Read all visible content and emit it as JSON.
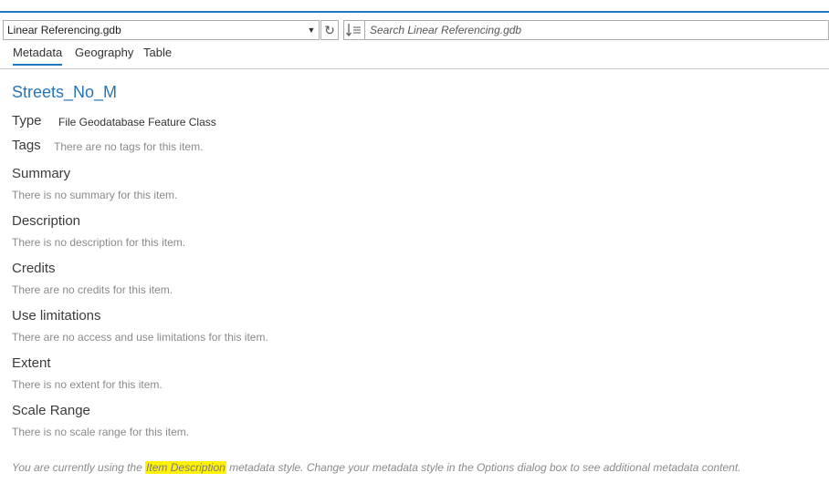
{
  "toolbar": {
    "gdb_selected": "Linear Referencing.gdb",
    "search_placeholder": "Search Linear Referencing.gdb"
  },
  "tabs": [
    {
      "label": "Metadata",
      "active": true
    },
    {
      "label": "Geography",
      "active": false
    },
    {
      "label": "Table",
      "active": false
    }
  ],
  "item": {
    "title": "Streets_No_M",
    "type_label": "Type",
    "type_value": "File Geodatabase Feature Class",
    "tags_label": "Tags",
    "tags_value": "There are no tags for this item."
  },
  "sections": [
    {
      "heading": "Summary",
      "text": "There is no summary for this item."
    },
    {
      "heading": "Description",
      "text": "There is no description for this item."
    },
    {
      "heading": "Credits",
      "text": "There are no credits for this item."
    },
    {
      "heading": "Use limitations",
      "text": "There are no access and use limitations for this item."
    },
    {
      "heading": "Extent",
      "text": "There is no extent for this item."
    },
    {
      "heading": "Scale Range",
      "text": "There is no scale range for this item."
    }
  ],
  "footer": {
    "prefix": "You are currently using the ",
    "style_name": "Item Description",
    "suffix": " metadata style. Change your metadata style in the Options dialog box to see additional metadata content."
  },
  "colors": {
    "accent": "#1f7ac4",
    "title": "#2774b8",
    "highlight": "#fff200"
  },
  "icons": {
    "dropdown": "chevron-down-icon",
    "refresh": "refresh-icon",
    "sort": "sort-icon"
  }
}
